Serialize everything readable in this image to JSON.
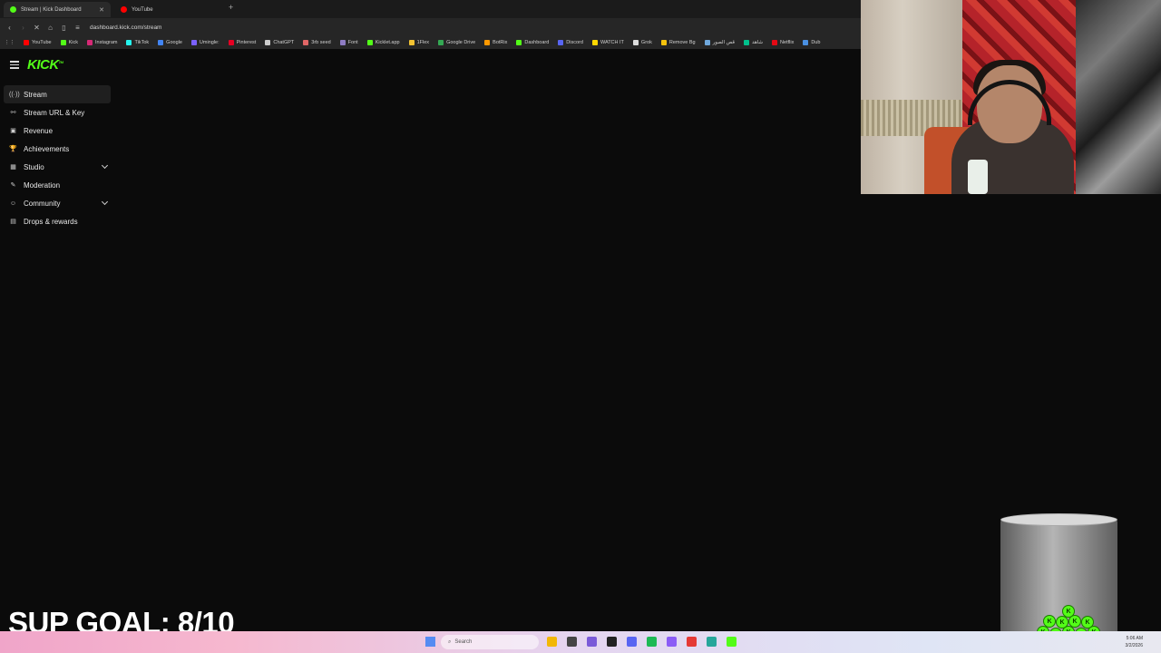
{
  "browser": {
    "tabs": [
      {
        "title": "Stream | Kick Dashboard",
        "favicon_color": "#53fc18",
        "active": true
      },
      {
        "title": "YouTube",
        "favicon_color": "#ff0000",
        "active": false
      }
    ],
    "new_tab_label": "+",
    "url": "dashboard.kick.com/stream",
    "bookmarks": [
      {
        "label": "YouTube",
        "color": "#ff0000"
      },
      {
        "label": "Kick",
        "color": "#53fc18"
      },
      {
        "label": "Instagram",
        "color": "#d62976"
      },
      {
        "label": "TikTok",
        "color": "#25f4ee"
      },
      {
        "label": "Google",
        "color": "#4285f4"
      },
      {
        "label": "Umingle:",
        "color": "#7b61ff"
      },
      {
        "label": "Pinterest",
        "color": "#e60023"
      },
      {
        "label": "ChatGPT",
        "color": "#cccccc"
      },
      {
        "label": "3rb seed",
        "color": "#e06666"
      },
      {
        "label": "Font",
        "color": "#8e7cc3"
      },
      {
        "label": "Kicklet.app",
        "color": "#53fc18"
      },
      {
        "label": "1Flex",
        "color": "#f1c232"
      },
      {
        "label": "Google Drive",
        "color": "#34a853"
      },
      {
        "label": "BotRix",
        "color": "#ff9900"
      },
      {
        "label": "Dashboard",
        "color": "#53fc18"
      },
      {
        "label": "Discord",
        "color": "#5865f2"
      },
      {
        "label": "WATCH IT",
        "color": "#ffd700"
      },
      {
        "label": "Grok",
        "color": "#dddddd"
      },
      {
        "label": "Remove Bg",
        "color": "#f4c20d"
      },
      {
        "label": "قص الصور",
        "color": "#6fa8dc"
      },
      {
        "label": "شاهد",
        "color": "#00c08b"
      },
      {
        "label": "Netflix",
        "color": "#e50914"
      },
      {
        "label": "Dub",
        "color": "#4a90e2"
      }
    ]
  },
  "app": {
    "logo": "KICK",
    "logo_tm": "TM",
    "nav": [
      {
        "label": "Stream",
        "icon": "broadcast-icon",
        "glyph": "((·))",
        "active": true,
        "expandable": false
      },
      {
        "label": "Stream URL & Key",
        "icon": "link-icon",
        "glyph": "⚯",
        "active": false,
        "expandable": false
      },
      {
        "label": "Revenue",
        "icon": "revenue-icon",
        "glyph": "▣",
        "active": false,
        "expandable": false
      },
      {
        "label": "Achievements",
        "icon": "trophy-icon",
        "glyph": "🏆",
        "active": false,
        "expandable": false
      },
      {
        "label": "Studio",
        "icon": "studio-icon",
        "glyph": "▦",
        "active": false,
        "expandable": true
      },
      {
        "label": "Moderation",
        "icon": "wrench-icon",
        "glyph": "✎",
        "active": false,
        "expandable": false
      },
      {
        "label": "Community",
        "icon": "community-icon",
        "glyph": "☺",
        "active": false,
        "expandable": true
      },
      {
        "label": "Drops & rewards",
        "icon": "gift-icon",
        "glyph": "▤",
        "active": false,
        "expandable": false
      }
    ]
  },
  "overlay": {
    "goal_text": "SUP GOAL: 8/10",
    "coin_letter": "K"
  },
  "taskbar": {
    "search_label": "Search",
    "time": "5:06 AM",
    "date": "3/2/2026"
  }
}
